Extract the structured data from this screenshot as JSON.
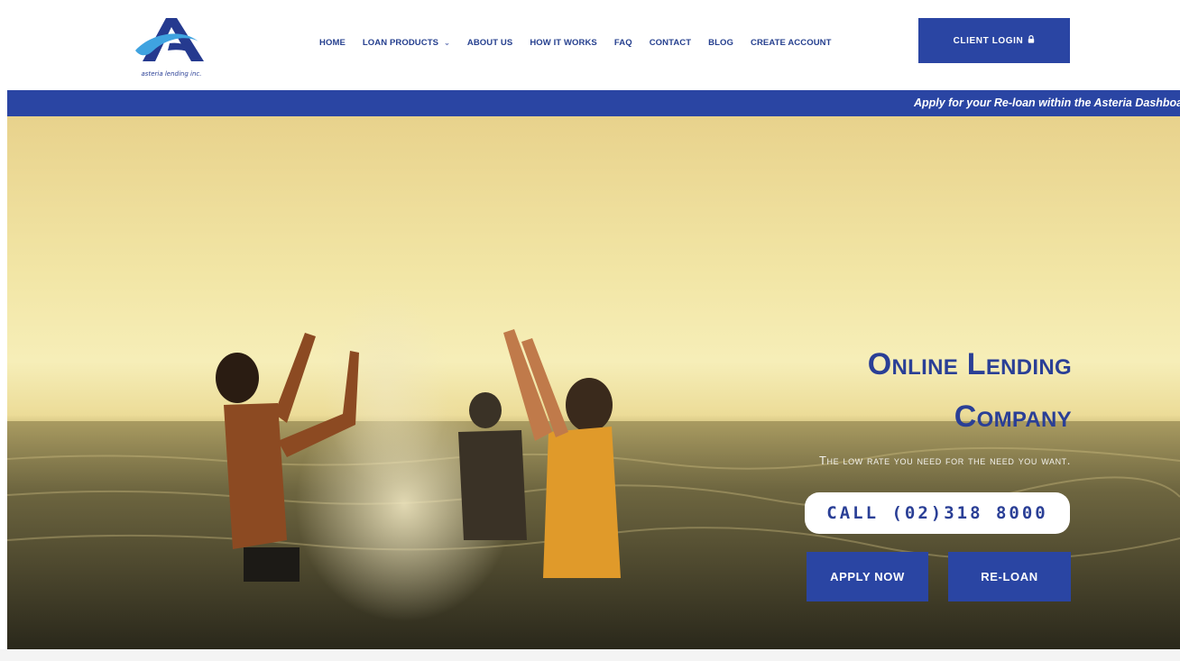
{
  "brand": {
    "logo_text": "asteria lending inc.",
    "primary_color": "#2a45a3",
    "logo_dark": "#253a8f",
    "logo_light": "#3fa3e0"
  },
  "nav": {
    "items": [
      {
        "label": "HOME"
      },
      {
        "label": "LOAN PRODUCTS",
        "has_dropdown": true,
        "dropdown_icon": "chevron-down-icon"
      },
      {
        "label": "ABOUT US"
      },
      {
        "label": "HOW IT WORKS"
      },
      {
        "label": "FAQ"
      },
      {
        "label": "CONTACT"
      },
      {
        "label": "BLOG"
      },
      {
        "label": "CREATE ACCOUNT"
      }
    ],
    "login_label": "CLIENT LOGIN",
    "login_icon": "lock-icon"
  },
  "ticker": {
    "text": "Apply for your Re-loan within the Asteria Dashboar"
  },
  "hero": {
    "title_line1": "Online Lending",
    "title_line2": "Company",
    "tagline": "The low rate you need for the need you want.",
    "call_label": "CALL (02)318 8000",
    "apply_label": "APPLY NOW",
    "reloan_label": "RE-LOAN"
  }
}
